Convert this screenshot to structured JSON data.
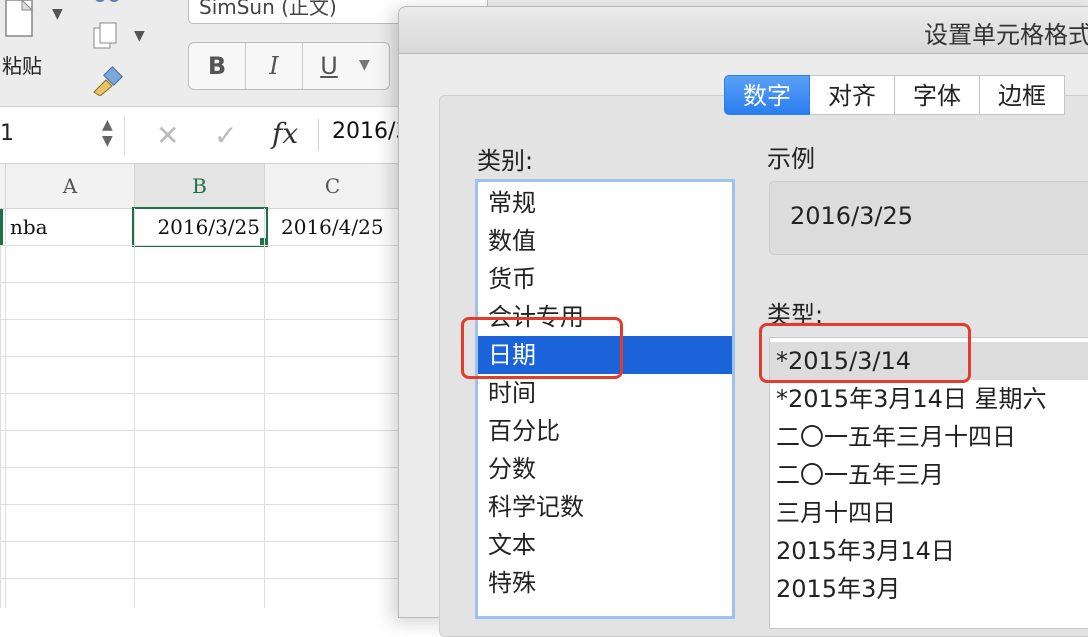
{
  "ribbon": {
    "paste_label": "粘贴",
    "font_name": "SimSun (正文)",
    "bold": "B",
    "italic": "I",
    "underline": "U"
  },
  "formula_bar": {
    "name_box": "1",
    "cancel": "✕",
    "confirm": "✓",
    "fx": "fx",
    "value": "2016/3/"
  },
  "grid": {
    "columns": [
      "A",
      "B",
      "C"
    ],
    "row1": [
      "nba",
      "2016/3/25",
      "2016/4/25"
    ]
  },
  "dialog": {
    "title": "设置单元格格式",
    "tabs": [
      "数字",
      "对齐",
      "字体",
      "边框"
    ],
    "active_tab": "数字",
    "category_label": "类别:",
    "categories": [
      "常规",
      "数值",
      "货币",
      "会计专用",
      "日期",
      "时间",
      "百分比",
      "分数",
      "科学记数",
      "文本",
      "特殊"
    ],
    "selected_category": "日期",
    "sample_label": "示例",
    "sample_value": "2016/3/25",
    "type_label": "类型:",
    "types": [
      "*2015/3/14",
      "*2015年3月14日 星期六",
      "二〇一五年三月十四日",
      "二〇一五年三月",
      "三月十四日",
      "2015年3月14日",
      "2015年3月"
    ],
    "selected_type": "*2015/3/14"
  },
  "colors": {
    "accent": "#2b7ef0",
    "selection": "#1a63d8",
    "highlight_box": "#e53b2e",
    "cell_border_active": "#1e7145"
  }
}
